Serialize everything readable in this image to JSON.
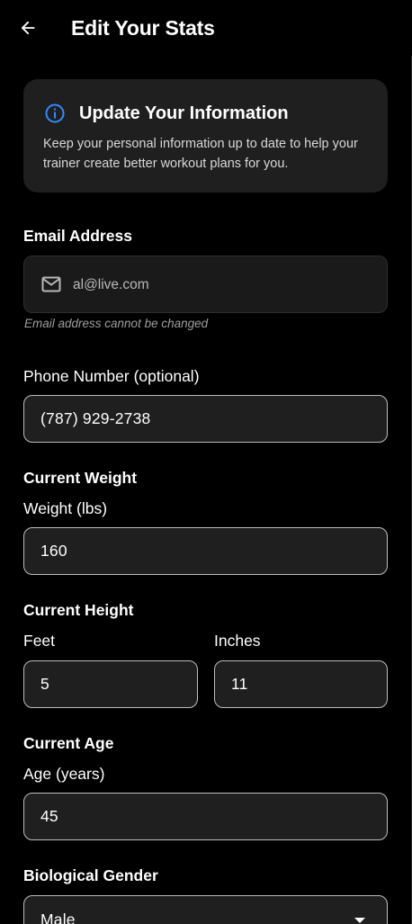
{
  "appbar": {
    "title": "Edit Your Stats",
    "back_icon": "arrow-left-icon"
  },
  "info_card": {
    "icon": "info-icon",
    "accent_color": "#2f8cff",
    "title": "Update Your Information",
    "body": "Keep your personal information up to date to help your trainer create better workout plans for you."
  },
  "email": {
    "section_label": "Email Address",
    "icon": "mail-icon",
    "value": "al@live.com",
    "note": "Email address cannot be changed"
  },
  "phone": {
    "label": "Phone Number (optional)",
    "value": "(787) 929-2738"
  },
  "weight": {
    "section_label": "Current Weight",
    "label": "Weight (lbs)",
    "value": "160"
  },
  "height": {
    "section_label": "Current Height",
    "feet_label": "Feet",
    "feet_value": "5",
    "inches_label": "Inches",
    "inches_value": "11"
  },
  "age": {
    "section_label": "Current Age",
    "label": "Age (years)",
    "value": "45"
  },
  "gender": {
    "section_label": "Biological Gender",
    "selected": "Male",
    "icon": "caret-down-icon"
  }
}
